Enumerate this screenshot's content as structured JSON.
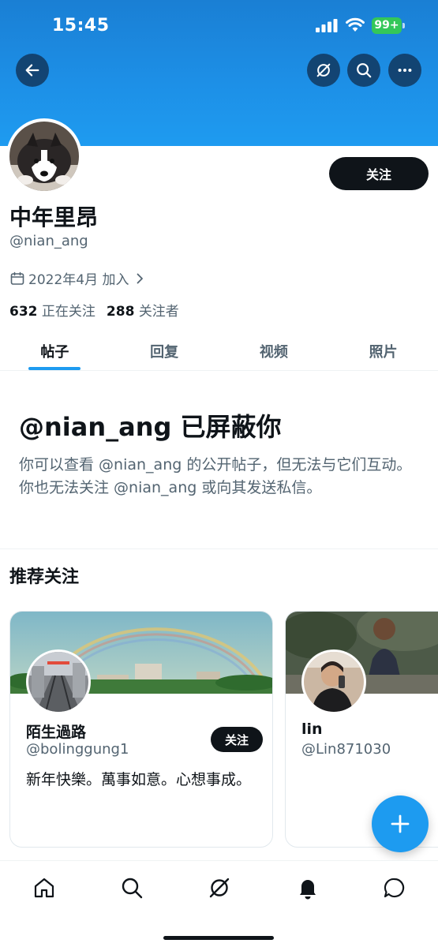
{
  "status_bar": {
    "time": "15:45",
    "battery": "99+"
  },
  "header": {
    "back_icon": "arrow-left-icon",
    "grok_icon": "slash-circle-icon",
    "search_icon": "search-icon",
    "more_icon": "more-icon"
  },
  "profile": {
    "display_name": "中年里昂",
    "handle": "@nian_ang",
    "joined": "2022年4月 加入",
    "following_count": "632",
    "following_label": "正在关注",
    "followers_count": "288",
    "followers_label": "关注者",
    "follow_label": "关注"
  },
  "tabs": [
    {
      "label": "帖子",
      "active": true
    },
    {
      "label": "回复",
      "active": false
    },
    {
      "label": "视频",
      "active": false
    },
    {
      "label": "照片",
      "active": false
    }
  ],
  "blocked": {
    "title": "@nian_ang 已屏蔽你",
    "message": "你可以查看 @nian_ang 的公开帖子，但无法与它们互动。你也无法关注 @nian_ang 或向其发送私信。"
  },
  "recommendations": {
    "title": "推荐关注",
    "cards": [
      {
        "name": "陌生過路",
        "handle": "@bolinggung1",
        "bio": "新年快樂。萬事如意。心想事成。",
        "follow_label": "关注"
      },
      {
        "name": "lin",
        "handle": "@Lin871030",
        "bio": ""
      }
    ]
  },
  "colors": {
    "accent": "#1d9bf0",
    "text": "#0f1419",
    "secondary": "#536471",
    "banner": "#1d8fe6"
  }
}
